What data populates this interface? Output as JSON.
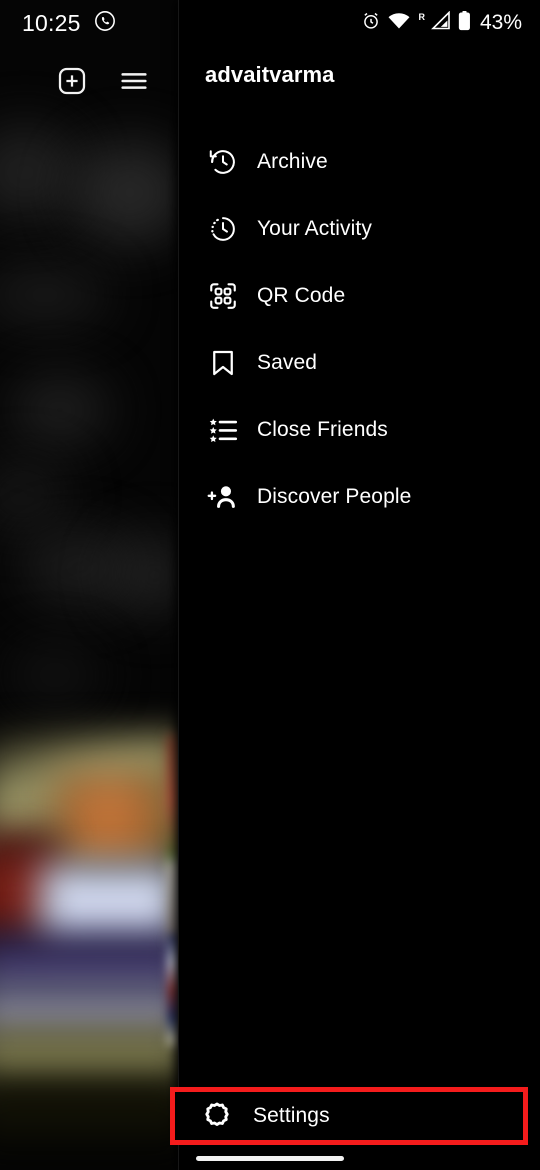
{
  "status_bar": {
    "time": "10:25",
    "whatsapp_icon": "whatsapp-icon",
    "alarm_icon": "alarm-icon",
    "wifi_icon": "wifi-icon",
    "roaming_label": "R",
    "signal_icon": "cellular-signal-icon",
    "battery_icon": "battery-icon",
    "battery_percent": "43%"
  },
  "background": {
    "new_post_icon": "plus-square-icon",
    "menu_icon": "hamburger-menu-icon"
  },
  "drawer": {
    "username": "advaitvarma",
    "items": [
      {
        "label": "Archive",
        "icon": "archive-clock-icon"
      },
      {
        "label": "Your Activity",
        "icon": "activity-clock-icon"
      },
      {
        "label": "QR Code",
        "icon": "qr-code-icon"
      },
      {
        "label": "Saved",
        "icon": "bookmark-icon"
      },
      {
        "label": "Close Friends",
        "icon": "star-list-icon"
      },
      {
        "label": "Discover People",
        "icon": "person-add-icon"
      }
    ],
    "settings": {
      "label": "Settings",
      "icon": "gear-icon",
      "highlight_color": "#f41c1c"
    }
  },
  "colors": {
    "background": "#000000",
    "text": "#ffffff",
    "highlight": "#f41c1c"
  }
}
